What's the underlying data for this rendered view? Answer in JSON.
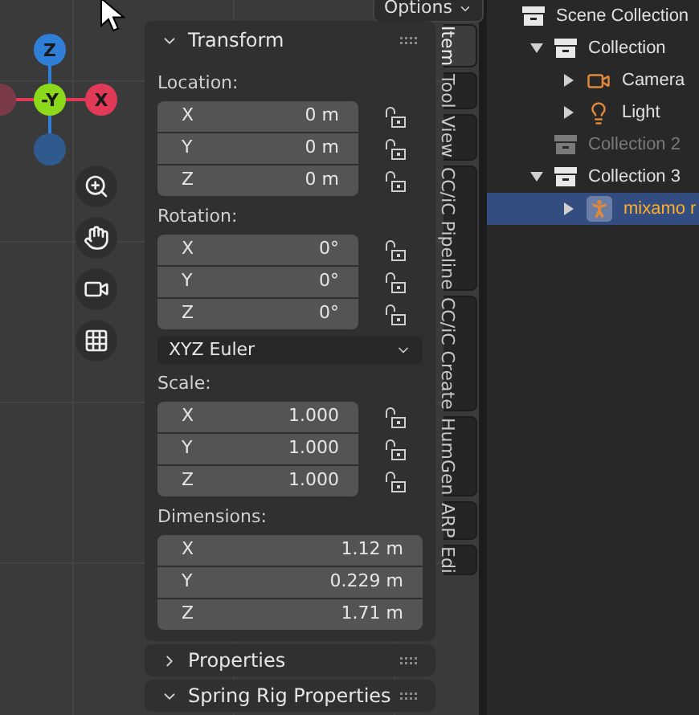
{
  "viewport": {
    "options_button": "Options",
    "gizmo": [
      {
        "label": "Z",
        "color": "#2f7fd8"
      },
      {
        "label": "-Y",
        "color": "#8bd91a"
      },
      {
        "label": "X",
        "color": "#e03a57"
      }
    ]
  },
  "sidebar": {
    "transform": {
      "title": "Transform",
      "expanded": true,
      "groups": [
        {
          "label": "Location:",
          "fields": [
            {
              "axis": "X",
              "value": "0 m",
              "locked": false
            },
            {
              "axis": "Y",
              "value": "0 m",
              "locked": false
            },
            {
              "axis": "Z",
              "value": "0 m",
              "locked": false
            }
          ]
        },
        {
          "label": "Rotation:",
          "fields": [
            {
              "axis": "X",
              "value": "0°",
              "locked": false
            },
            {
              "axis": "Y",
              "value": "0°",
              "locked": false
            },
            {
              "axis": "Z",
              "value": "0°",
              "locked": false
            }
          ],
          "mode": "XYZ Euler"
        },
        {
          "label": "Scale:",
          "fields": [
            {
              "axis": "X",
              "value": "1.000",
              "locked": false
            },
            {
              "axis": "Y",
              "value": "1.000",
              "locked": false
            },
            {
              "axis": "Z",
              "value": "1.000",
              "locked": false
            }
          ]
        },
        {
          "label": "Dimensions:",
          "fields": [
            {
              "axis": "X",
              "value": "1.12 m"
            },
            {
              "axis": "Y",
              "value": "0.229 m"
            },
            {
              "axis": "Z",
              "value": "1.71 m"
            }
          ]
        }
      ]
    },
    "subpanels": [
      {
        "title": "Properties",
        "expanded": false
      },
      {
        "title": "Spring Rig Properties",
        "expanded": true
      }
    ],
    "tabs": [
      {
        "label": "Item",
        "selected": true
      },
      {
        "label": "Tool",
        "selected": false
      },
      {
        "label": "View",
        "selected": false
      },
      {
        "label": "CC/iC Pipeline",
        "selected": false
      },
      {
        "label": "CC/iC Create",
        "selected": false
      },
      {
        "label": "HumGen",
        "selected": false
      },
      {
        "label": "ARP",
        "selected": false
      },
      {
        "label": "Edi",
        "selected": false
      }
    ]
  },
  "outliner": {
    "items": [
      {
        "name": "Scene Collection",
        "kind": "collection",
        "disabled": false,
        "selected": false,
        "children": [
          {
            "name": "Collection",
            "kind": "collection",
            "expanded": true,
            "disabled": false,
            "selected": false,
            "children": [
              {
                "name": "Camera",
                "kind": "camera",
                "expanded": false,
                "disabled": false,
                "selected": false
              },
              {
                "name": "Light",
                "kind": "light",
                "expanded": false,
                "disabled": false,
                "selected": false
              }
            ]
          },
          {
            "name": "Collection 2",
            "kind": "collection",
            "disabled": true,
            "selected": false
          },
          {
            "name": "Collection 3",
            "kind": "collection",
            "expanded": true,
            "disabled": false,
            "selected": false,
            "children": [
              {
                "name": "mixamo r",
                "kind": "armature",
                "expanded": false,
                "disabled": false,
                "selected": true
              }
            ]
          }
        ]
      }
    ]
  }
}
